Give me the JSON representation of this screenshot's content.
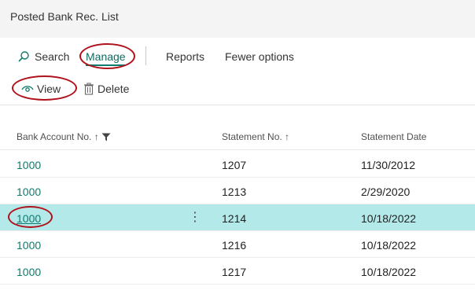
{
  "page": {
    "title": "Posted Bank Rec. List"
  },
  "actions": {
    "search": "Search",
    "manage": "Manage",
    "reports": "Reports",
    "fewer_options": "Fewer options",
    "view": "View",
    "delete": "Delete"
  },
  "table": {
    "columns": {
      "bank_account_no": "Bank Account No. ↑",
      "statement_no": "Statement No. ↑",
      "statement_date": "Statement Date"
    },
    "rows": [
      {
        "bank_account_no": "1000",
        "statement_no": "1207",
        "statement_date": "11/30/2012"
      },
      {
        "bank_account_no": "1000",
        "statement_no": "1213",
        "statement_date": "2/29/2020"
      },
      {
        "bank_account_no": "1000",
        "statement_no": "1214",
        "statement_date": "10/18/2022"
      },
      {
        "bank_account_no": "1000",
        "statement_no": "1216",
        "statement_date": "10/18/2022"
      },
      {
        "bank_account_no": "1000",
        "statement_no": "1217",
        "statement_date": "10/18/2022"
      }
    ],
    "selected_row": 2
  },
  "icons": {
    "search": "search-icon",
    "view": "eye-icon",
    "delete": "trash-icon",
    "filter": "filter-icon",
    "row_menu": "more-vertical-icon"
  },
  "colors": {
    "accent": "#0f7b6c",
    "selected_row": "#b4e9ea",
    "highlight": "#b0121b"
  }
}
